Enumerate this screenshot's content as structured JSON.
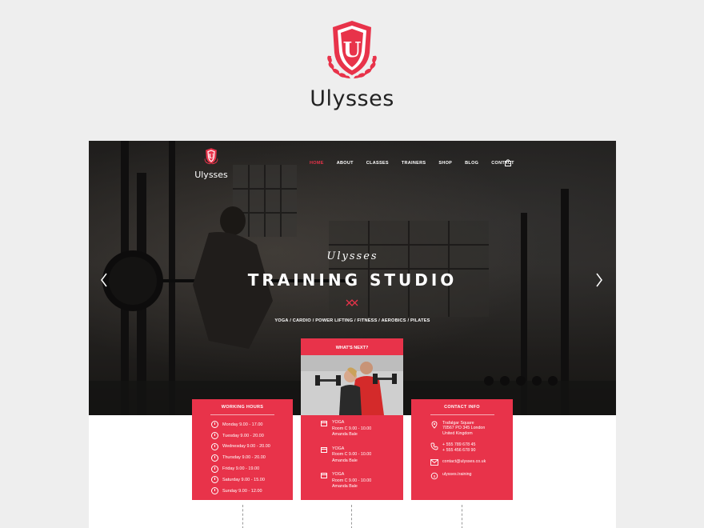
{
  "brand": {
    "name": "Ulysses",
    "crest_letter": "U",
    "accent": "#e8334a"
  },
  "preview": {
    "logo": {
      "name": "Ulysses",
      "crest_letter": "U"
    },
    "nav": [
      "HOME",
      "ABOUT",
      "CLASSES",
      "TRAINERS",
      "SHOP",
      "BLOG",
      "CONTACT"
    ],
    "nav_active": "HOME",
    "icons": {
      "cart": "shopping-bag-icon",
      "prev": "chevron-left-icon",
      "next": "chevron-right-icon"
    },
    "hero": {
      "script": "Ulysses",
      "title": "TRAINING STUDIO",
      "subtitle": "YOGA / CARDIO / POWER LIFTING / FITNESS / AEROBICS  / PILATES"
    },
    "working_hours": {
      "title": "WORKING HOURS",
      "rows": [
        "Monday 9.00 - 17.00",
        "Tuesday 9.00 - 20.00",
        "Wednesday 9.00 - 20.00",
        "Thursday 9.00 - 20.00",
        "Friday 9.00 - 19.00",
        "Saturday 9.00 - 15.00",
        "Sunday 9.00 - 12.00"
      ]
    },
    "whats_next": {
      "title": "WHAT'S NEXT?",
      "classes": [
        {
          "name": "YOGA",
          "room": "Room C 9.00 - 10.00",
          "trainer": "Amanda Bale"
        },
        {
          "name": "YOGA",
          "room": "Room C 9.00 - 10.00",
          "trainer": "Amanda Bale"
        },
        {
          "name": "YOGA",
          "room": "Room C 9.00 - 10.00",
          "trainer": "Amanda Bale"
        }
      ]
    },
    "contact": {
      "title": "CONTACT INFO",
      "address": [
        "Trafalgar Square",
        "70567 PO 345 London",
        "United Kingdom"
      ],
      "phones": [
        "+ 555 789 678 45",
        "+ 555 456 678 90"
      ],
      "email": "contact@ulysses.co.uk",
      "skype": "ulysses.training"
    }
  }
}
